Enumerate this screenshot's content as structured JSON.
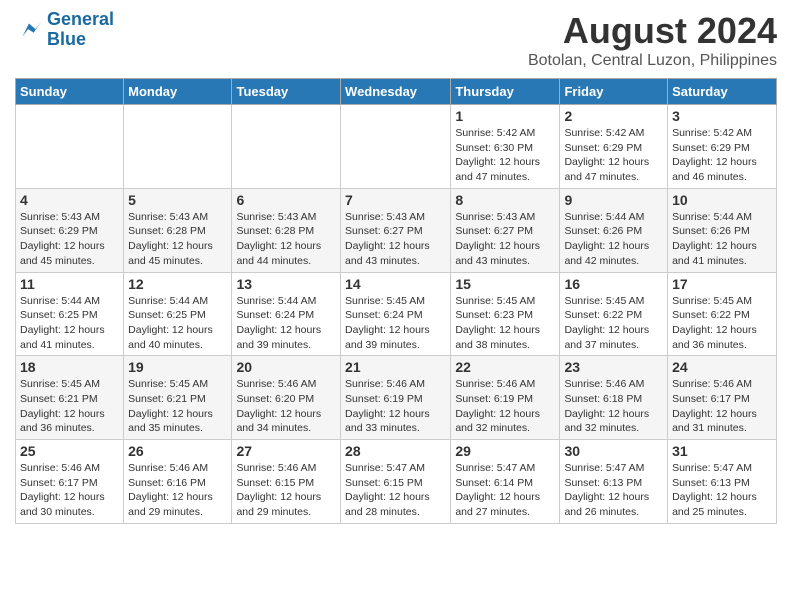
{
  "logo": {
    "line1": "General",
    "line2": "Blue"
  },
  "title": "August 2024",
  "subtitle": "Botolan, Central Luzon, Philippines",
  "days_of_week": [
    "Sunday",
    "Monday",
    "Tuesday",
    "Wednesday",
    "Thursday",
    "Friday",
    "Saturday"
  ],
  "weeks": [
    [
      {
        "day": "",
        "sunrise": "",
        "sunset": "",
        "daylight": ""
      },
      {
        "day": "",
        "sunrise": "",
        "sunset": "",
        "daylight": ""
      },
      {
        "day": "",
        "sunrise": "",
        "sunset": "",
        "daylight": ""
      },
      {
        "day": "",
        "sunrise": "",
        "sunset": "",
        "daylight": ""
      },
      {
        "day": "1",
        "sunrise": "Sunrise: 5:42 AM",
        "sunset": "Sunset: 6:30 PM",
        "daylight": "Daylight: 12 hours and 47 minutes."
      },
      {
        "day": "2",
        "sunrise": "Sunrise: 5:42 AM",
        "sunset": "Sunset: 6:29 PM",
        "daylight": "Daylight: 12 hours and 47 minutes."
      },
      {
        "day": "3",
        "sunrise": "Sunrise: 5:42 AM",
        "sunset": "Sunset: 6:29 PM",
        "daylight": "Daylight: 12 hours and 46 minutes."
      }
    ],
    [
      {
        "day": "4",
        "sunrise": "Sunrise: 5:43 AM",
        "sunset": "Sunset: 6:29 PM",
        "daylight": "Daylight: 12 hours and 45 minutes."
      },
      {
        "day": "5",
        "sunrise": "Sunrise: 5:43 AM",
        "sunset": "Sunset: 6:28 PM",
        "daylight": "Daylight: 12 hours and 45 minutes."
      },
      {
        "day": "6",
        "sunrise": "Sunrise: 5:43 AM",
        "sunset": "Sunset: 6:28 PM",
        "daylight": "Daylight: 12 hours and 44 minutes."
      },
      {
        "day": "7",
        "sunrise": "Sunrise: 5:43 AM",
        "sunset": "Sunset: 6:27 PM",
        "daylight": "Daylight: 12 hours and 43 minutes."
      },
      {
        "day": "8",
        "sunrise": "Sunrise: 5:43 AM",
        "sunset": "Sunset: 6:27 PM",
        "daylight": "Daylight: 12 hours and 43 minutes."
      },
      {
        "day": "9",
        "sunrise": "Sunrise: 5:44 AM",
        "sunset": "Sunset: 6:26 PM",
        "daylight": "Daylight: 12 hours and 42 minutes."
      },
      {
        "day": "10",
        "sunrise": "Sunrise: 5:44 AM",
        "sunset": "Sunset: 6:26 PM",
        "daylight": "Daylight: 12 hours and 41 minutes."
      }
    ],
    [
      {
        "day": "11",
        "sunrise": "Sunrise: 5:44 AM",
        "sunset": "Sunset: 6:25 PM",
        "daylight": "Daylight: 12 hours and 41 minutes."
      },
      {
        "day": "12",
        "sunrise": "Sunrise: 5:44 AM",
        "sunset": "Sunset: 6:25 PM",
        "daylight": "Daylight: 12 hours and 40 minutes."
      },
      {
        "day": "13",
        "sunrise": "Sunrise: 5:44 AM",
        "sunset": "Sunset: 6:24 PM",
        "daylight": "Daylight: 12 hours and 39 minutes."
      },
      {
        "day": "14",
        "sunrise": "Sunrise: 5:45 AM",
        "sunset": "Sunset: 6:24 PM",
        "daylight": "Daylight: 12 hours and 39 minutes."
      },
      {
        "day": "15",
        "sunrise": "Sunrise: 5:45 AM",
        "sunset": "Sunset: 6:23 PM",
        "daylight": "Daylight: 12 hours and 38 minutes."
      },
      {
        "day": "16",
        "sunrise": "Sunrise: 5:45 AM",
        "sunset": "Sunset: 6:22 PM",
        "daylight": "Daylight: 12 hours and 37 minutes."
      },
      {
        "day": "17",
        "sunrise": "Sunrise: 5:45 AM",
        "sunset": "Sunset: 6:22 PM",
        "daylight": "Daylight: 12 hours and 36 minutes."
      }
    ],
    [
      {
        "day": "18",
        "sunrise": "Sunrise: 5:45 AM",
        "sunset": "Sunset: 6:21 PM",
        "daylight": "Daylight: 12 hours and 36 minutes."
      },
      {
        "day": "19",
        "sunrise": "Sunrise: 5:45 AM",
        "sunset": "Sunset: 6:21 PM",
        "daylight": "Daylight: 12 hours and 35 minutes."
      },
      {
        "day": "20",
        "sunrise": "Sunrise: 5:46 AM",
        "sunset": "Sunset: 6:20 PM",
        "daylight": "Daylight: 12 hours and 34 minutes."
      },
      {
        "day": "21",
        "sunrise": "Sunrise: 5:46 AM",
        "sunset": "Sunset: 6:19 PM",
        "daylight": "Daylight: 12 hours and 33 minutes."
      },
      {
        "day": "22",
        "sunrise": "Sunrise: 5:46 AM",
        "sunset": "Sunset: 6:19 PM",
        "daylight": "Daylight: 12 hours and 32 minutes."
      },
      {
        "day": "23",
        "sunrise": "Sunrise: 5:46 AM",
        "sunset": "Sunset: 6:18 PM",
        "daylight": "Daylight: 12 hours and 32 minutes."
      },
      {
        "day": "24",
        "sunrise": "Sunrise: 5:46 AM",
        "sunset": "Sunset: 6:17 PM",
        "daylight": "Daylight: 12 hours and 31 minutes."
      }
    ],
    [
      {
        "day": "25",
        "sunrise": "Sunrise: 5:46 AM",
        "sunset": "Sunset: 6:17 PM",
        "daylight": "Daylight: 12 hours and 30 minutes."
      },
      {
        "day": "26",
        "sunrise": "Sunrise: 5:46 AM",
        "sunset": "Sunset: 6:16 PM",
        "daylight": "Daylight: 12 hours and 29 minutes."
      },
      {
        "day": "27",
        "sunrise": "Sunrise: 5:46 AM",
        "sunset": "Sunset: 6:15 PM",
        "daylight": "Daylight: 12 hours and 29 minutes."
      },
      {
        "day": "28",
        "sunrise": "Sunrise: 5:47 AM",
        "sunset": "Sunset: 6:15 PM",
        "daylight": "Daylight: 12 hours and 28 minutes."
      },
      {
        "day": "29",
        "sunrise": "Sunrise: 5:47 AM",
        "sunset": "Sunset: 6:14 PM",
        "daylight": "Daylight: 12 hours and 27 minutes."
      },
      {
        "day": "30",
        "sunrise": "Sunrise: 5:47 AM",
        "sunset": "Sunset: 6:13 PM",
        "daylight": "Daylight: 12 hours and 26 minutes."
      },
      {
        "day": "31",
        "sunrise": "Sunrise: 5:47 AM",
        "sunset": "Sunset: 6:13 PM",
        "daylight": "Daylight: 12 hours and 25 minutes."
      }
    ]
  ]
}
